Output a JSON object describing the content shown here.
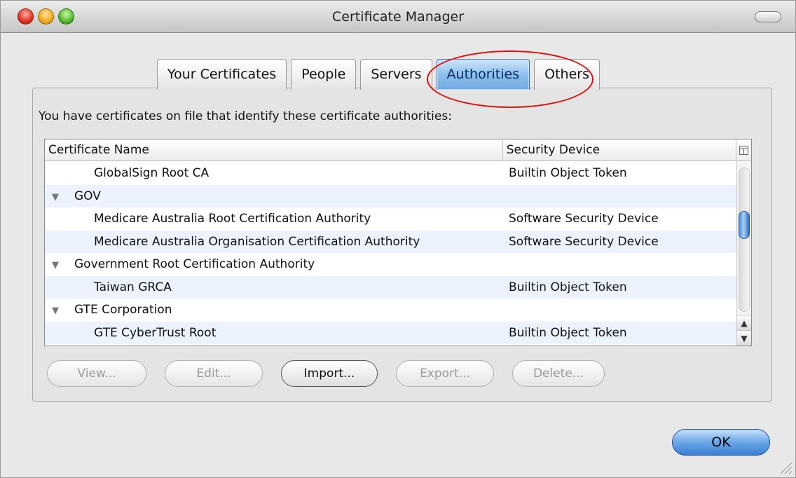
{
  "window": {
    "title": "Certificate Manager"
  },
  "tabs": [
    {
      "label": "Your Certificates",
      "active": false
    },
    {
      "label": "People",
      "active": false
    },
    {
      "label": "Servers",
      "active": false
    },
    {
      "label": "Authorities",
      "active": true
    },
    {
      "label": "Others",
      "active": false
    }
  ],
  "panel": {
    "intro": "You have certificates on file that identify these certificate authorities:"
  },
  "table": {
    "columns": [
      "Certificate Name",
      "Security Device"
    ],
    "rows": [
      {
        "name": "GlobalSign Root CA",
        "device": "Builtin Object Token",
        "type": "child"
      },
      {
        "name": "GOV",
        "device": "",
        "type": "group"
      },
      {
        "name": "Medicare Australia Root Certification Authority",
        "device": "Software Security Device",
        "type": "child"
      },
      {
        "name": "Medicare Australia Organisation Certification Authority",
        "device": "Software Security Device",
        "type": "child"
      },
      {
        "name": "Government Root Certification Authority",
        "device": "",
        "type": "group"
      },
      {
        "name": "Taiwan GRCA",
        "device": "Builtin Object Token",
        "type": "child"
      },
      {
        "name": "GTE Corporation",
        "device": "",
        "type": "group"
      },
      {
        "name": "GTE CyberTrust Root",
        "device": "Builtin Object Token",
        "type": "child"
      }
    ]
  },
  "buttons": {
    "view": "View...",
    "edit": "Edit...",
    "import": "Import...",
    "export": "Export...",
    "delete": "Delete...",
    "ok": "OK"
  },
  "icons": {
    "expanded": "triangle-down-icon",
    "column_picker": "column-picker-icon"
  },
  "colors": {
    "accent": "#6fa9e2",
    "annotation": "#e01010",
    "alt_row": "#edf3fe"
  }
}
